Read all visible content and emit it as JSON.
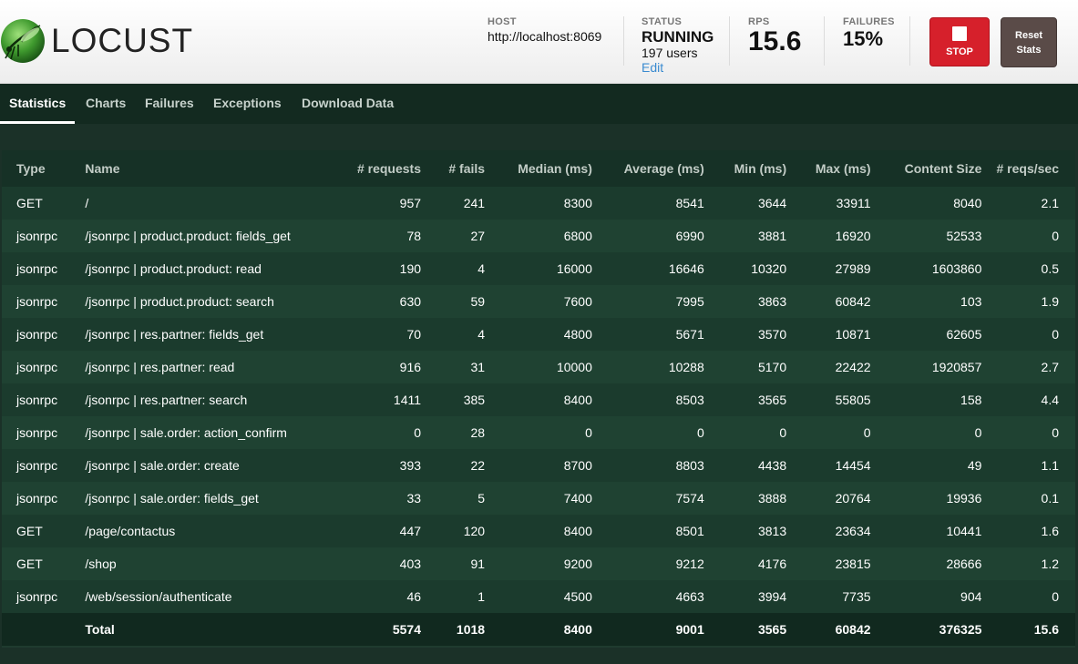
{
  "app": {
    "logo_text": "LOCUST"
  },
  "header": {
    "host_label": "HOST",
    "host_value": "http://localhost:8069",
    "status_label": "STATUS",
    "status_value": "RUNNING",
    "status_users": "197 users",
    "status_edit": "Edit",
    "rps_label": "RPS",
    "rps_value": "15.6",
    "failures_label": "FAILURES",
    "failures_value": "15%",
    "stop_label": "STOP",
    "reset_label_line1": "Reset",
    "reset_label_line2": "Stats"
  },
  "colors": {
    "stop": "#d6202b",
    "reset": "#5a4b48",
    "accent_link": "#3a8bd0",
    "bg": "#1b3128"
  },
  "tabs": [
    {
      "label": "Statistics",
      "active": true
    },
    {
      "label": "Charts",
      "active": false
    },
    {
      "label": "Failures",
      "active": false
    },
    {
      "label": "Exceptions",
      "active": false
    },
    {
      "label": "Download Data",
      "active": false
    }
  ],
  "table": {
    "headers": [
      "Type",
      "Name",
      "# requests",
      "# fails",
      "Median (ms)",
      "Average (ms)",
      "Min (ms)",
      "Max (ms)",
      "Content Size",
      "# reqs/sec"
    ],
    "rows": [
      [
        "GET",
        "/",
        "957",
        "241",
        "8300",
        "8541",
        "3644",
        "33911",
        "8040",
        "2.1"
      ],
      [
        "jsonrpc",
        "/jsonrpc | product.product: fields_get",
        "78",
        "27",
        "6800",
        "6990",
        "3881",
        "16920",
        "52533",
        "0"
      ],
      [
        "jsonrpc",
        "/jsonrpc | product.product: read",
        "190",
        "4",
        "16000",
        "16646",
        "10320",
        "27989",
        "1603860",
        "0.5"
      ],
      [
        "jsonrpc",
        "/jsonrpc | product.product: search",
        "630",
        "59",
        "7600",
        "7995",
        "3863",
        "60842",
        "103",
        "1.9"
      ],
      [
        "jsonrpc",
        "/jsonrpc | res.partner: fields_get",
        "70",
        "4",
        "4800",
        "5671",
        "3570",
        "10871",
        "62605",
        "0"
      ],
      [
        "jsonrpc",
        "/jsonrpc | res.partner: read",
        "916",
        "31",
        "10000",
        "10288",
        "5170",
        "22422",
        "1920857",
        "2.7"
      ],
      [
        "jsonrpc",
        "/jsonrpc | res.partner: search",
        "1411",
        "385",
        "8400",
        "8503",
        "3565",
        "55805",
        "158",
        "4.4"
      ],
      [
        "jsonrpc",
        "/jsonrpc | sale.order: action_confirm",
        "0",
        "28",
        "0",
        "0",
        "0",
        "0",
        "0",
        "0"
      ],
      [
        "jsonrpc",
        "/jsonrpc | sale.order: create",
        "393",
        "22",
        "8700",
        "8803",
        "4438",
        "14454",
        "49",
        "1.1"
      ],
      [
        "jsonrpc",
        "/jsonrpc | sale.order: fields_get",
        "33",
        "5",
        "7400",
        "7574",
        "3888",
        "20764",
        "19936",
        "0.1"
      ],
      [
        "GET",
        "/page/contactus",
        "447",
        "120",
        "8400",
        "8501",
        "3813",
        "23634",
        "10441",
        "1.6"
      ],
      [
        "GET",
        "/shop",
        "403",
        "91",
        "9200",
        "9212",
        "4176",
        "23815",
        "28666",
        "1.2"
      ],
      [
        "jsonrpc",
        "/web/session/authenticate",
        "46",
        "1",
        "4500",
        "4663",
        "3994",
        "7735",
        "904",
        "0"
      ]
    ],
    "total": [
      "",
      "Total",
      "5574",
      "1018",
      "8400",
      "9001",
      "3565",
      "60842",
      "376325",
      "15.6"
    ]
  }
}
